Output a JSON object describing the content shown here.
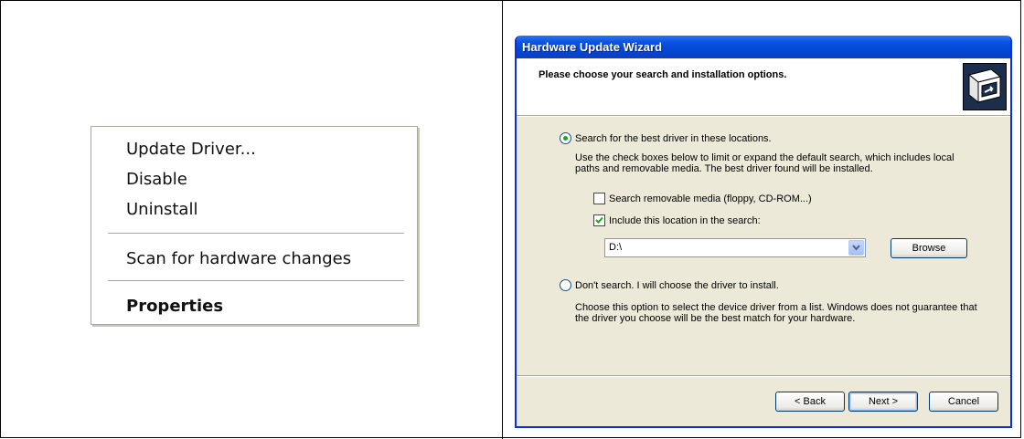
{
  "context_menu": {
    "items": [
      {
        "label": "Update Driver..."
      },
      {
        "label": "Disable"
      },
      {
        "label": "Uninstall"
      },
      {
        "label": "Scan for hardware changes"
      },
      {
        "label": "Properties"
      }
    ]
  },
  "wizard": {
    "title": "Hardware Update Wizard",
    "header_title": "Please choose your search and installation options.",
    "header_icon": "hardware-wizard-icon",
    "option_search": {
      "label": "Search for the best driver in these locations.",
      "selected": true,
      "description_line1": "Use the check boxes below to limit or expand the default search, which includes local",
      "description_line2": "paths and removable media. The best driver found will be installed."
    },
    "checkbox_removable": {
      "label": "Search removable media (floppy, CD-ROM...)",
      "checked": false
    },
    "checkbox_location": {
      "label": "Include this location in the search:",
      "checked": true
    },
    "location_value": "D:\\",
    "browse_label": "Browse",
    "option_manual": {
      "label": "Don't search. I will choose the driver to install.",
      "selected": false,
      "description_line1": "Choose this option to select the device driver from a list.  Windows does not guarantee that",
      "description_line2": "the driver you choose will be the best match for your hardware."
    },
    "buttons": {
      "back": "< Back",
      "next": "Next >",
      "cancel": "Cancel"
    }
  }
}
